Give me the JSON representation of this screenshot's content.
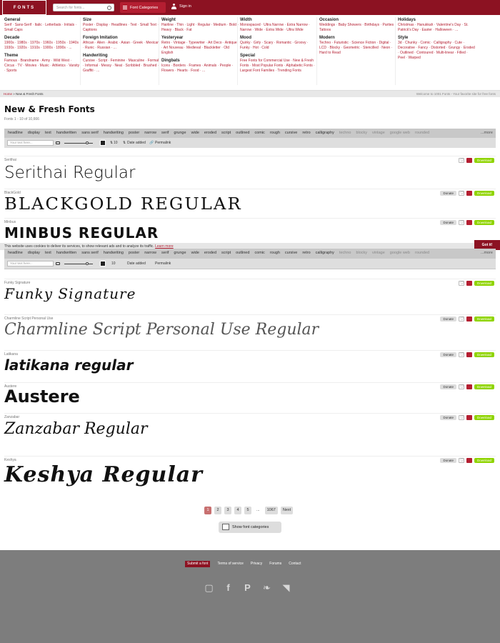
{
  "header": {
    "logo_text": "FONTS",
    "search_placeholder": "Search for fonts...",
    "categories_label": "Font Categories",
    "signin_label": "Sign in"
  },
  "menu": [
    {
      "col": 0,
      "groups": [
        {
          "title": "General",
          "links": "Serif · Sans-Serif · Italic · Letterbats · Initials · Small Caps"
        },
        {
          "title": "Decade",
          "links": "1900s · 1980s · 1970s · 1960s · 1950s · 1940s · 1930s · 1920s · 1910s · 1900s · 1890s · ..."
        },
        {
          "title": "Theme",
          "links": "Famous · Brandname · Army · Wild West · Circus · TV · Movies · Music · Athletics · Varsity · Sports"
        }
      ]
    },
    {
      "col": 1,
      "groups": [
        {
          "title": "Size",
          "links": "Poster · Display · Headlines · Text · Small Text · Captions"
        },
        {
          "title": "Foreign Imitation",
          "links": "African · Alien · Arabic · Asian · Greek · Mexican · Runic · Russian · ..."
        },
        {
          "title": "Handwriting",
          "links": "Cursive · Script · Feminine · Masculine · Formal · Informal · Messy · Neat · Scribbled · Brushed · Graffiti · ..."
        }
      ]
    },
    {
      "col": 2,
      "groups": [
        {
          "title": "Weight",
          "links": "Hairline · Thin · Light · Regular · Medium · Bold · Heavy · Black · Fat"
        },
        {
          "title": "Yesteryear",
          "links": "Retro · Vintage · Typewriter · Art Deco · Antique · Art Nouveau · Medieval · Blackletter · Old English"
        },
        {
          "title": "Dingbats",
          "links": "Icons · Borders · Frames · Animals · People · Flowers · Hearts · Food · ..."
        }
      ]
    },
    {
      "col": 3,
      "groups": [
        {
          "title": "Width",
          "links": "Monospaced · Ultra Narrow · Extra Narrow · Narrow · Wide · Extra Wide · Ultra Wide"
        },
        {
          "title": "Mood",
          "links": "Quirky · Girly · Scary · Romantic · Groovy · Funky · Hot · Cold"
        },
        {
          "title": "Special",
          "links": "Free Fonts for Commercial Use · New & Fresh Fonts · Most Popular Fonts · Alphabetic Fonts · Largest Font Families · Trending Fonts"
        }
      ]
    },
    {
      "col": 4,
      "groups": [
        {
          "title": "Occasion",
          "links": "Weddings · Baby Showers · Birthdays · Parties · Tattoos"
        },
        {
          "title": "Modern",
          "links": "Techno · Futuristic · Science Fiction · Digital · LCD · Blocky · Geometric · Stencilled · Neon · Hard to Read"
        }
      ]
    },
    {
      "col": 5,
      "groups": [
        {
          "title": "Holidays",
          "links": "Christmas · Hanukkah · Valentine's Day · St. Patrick's Day · Easter · Halloween · ..."
        },
        {
          "title": "Style",
          "links": "3d · Chunky · Comic · Calligraphy · Cute · Decorative · Fancy · Distorted · Grungy · Eroded · Outlined · Contoured · Multi-linear · Filled · Peel · Warped"
        }
      ]
    }
  ],
  "breadcrumb": {
    "home": "Home",
    "sep": " » ",
    "current": "New & Fresh Fonts",
    "welcome": "Welcome to 1001 Fonts - Your favorite site for free fonts"
  },
  "page": {
    "title": "New & Fresh Fonts",
    "count": "Fonts 1 - 10 of 10,666"
  },
  "filters": {
    "tags": [
      "headline",
      "display",
      "text",
      "handwritten",
      "sans serif",
      "handwriting",
      "poster",
      "narrow",
      "serif",
      "grunge",
      "wide",
      "eroded",
      "script",
      "outlined",
      "comic",
      "rough",
      "cursive",
      "retro",
      "calligraphy"
    ],
    "dim_tags": [
      "techno",
      "blocky",
      "vintage",
      "google web",
      "rounded"
    ],
    "more": "...more",
    "preview_placeholder": "Your text here...",
    "size": "10",
    "sort": "Date added",
    "permalink": "Permalink"
  },
  "cookie": {
    "text": "This website uses cookies to deliver its services, to show relevant ads and to analyze its traffic.",
    "learn": "Learn more",
    "gotit": "Got it!"
  },
  "fonts": [
    {
      "name": "Serithai",
      "preview": "Serithai Regular",
      "donate": ""
    },
    {
      "name": "BlackGold",
      "preview": "BLACKGOLD REGULAR",
      "donate": "Donate"
    },
    {
      "name": "Minbus",
      "preview": "MINBUS REGULAR",
      "donate": "Donate"
    },
    {
      "name": "Funky Signature",
      "preview": "Funky Signature",
      "donate": ""
    },
    {
      "name": "Charmline Script Personal Use",
      "preview": "Charmline Script Personal Use Regular",
      "donate": "Donate"
    },
    {
      "name": "Latikana",
      "preview": "latikana regular",
      "donate": "Donate"
    },
    {
      "name": "Austere",
      "preview": "Austere",
      "donate": "Donate"
    },
    {
      "name": "Zanzabar",
      "preview": "Zanzabar Regular",
      "donate": "Donate"
    },
    {
      "name": "Keshya",
      "preview": "Keshya Regular",
      "donate": "Donate"
    }
  ],
  "download_label": "Download",
  "pagination": [
    "1",
    "2",
    "3",
    "4",
    "5",
    "...",
    "1067",
    "Next"
  ],
  "show_categories": "Show font categories",
  "footer": {
    "links": [
      "Submit a font",
      "Terms of service",
      "Privacy",
      "Forums",
      "Contact"
    ],
    "social": [
      "instagram-icon",
      "facebook-icon",
      "pinterest-icon",
      "twitter-icon",
      "rss-icon"
    ]
  },
  "colors": {
    "brand": "#8c1222",
    "accent": "#b41e31",
    "download": "#8fd400",
    "footer": "#7d7d7d"
  }
}
